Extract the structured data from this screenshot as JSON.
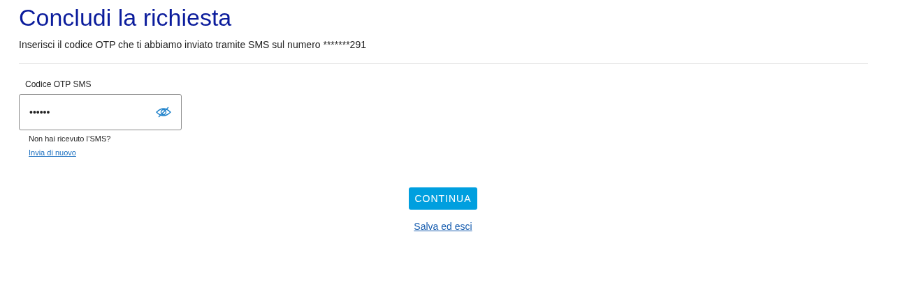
{
  "title": "Concludi la richiesta",
  "instructions": "Inserisci il codice OTP che ti abbiamo inviato tramite SMS sul numero *******291",
  "otp_field": {
    "label": "Codice OTP SMS",
    "value": "••••••"
  },
  "help": {
    "text": "Non hai ricevuto l’SMS?",
    "link": "Invia di nuovo"
  },
  "primary_button": "CONTINUA",
  "secondary_link": "Salva ed esci"
}
